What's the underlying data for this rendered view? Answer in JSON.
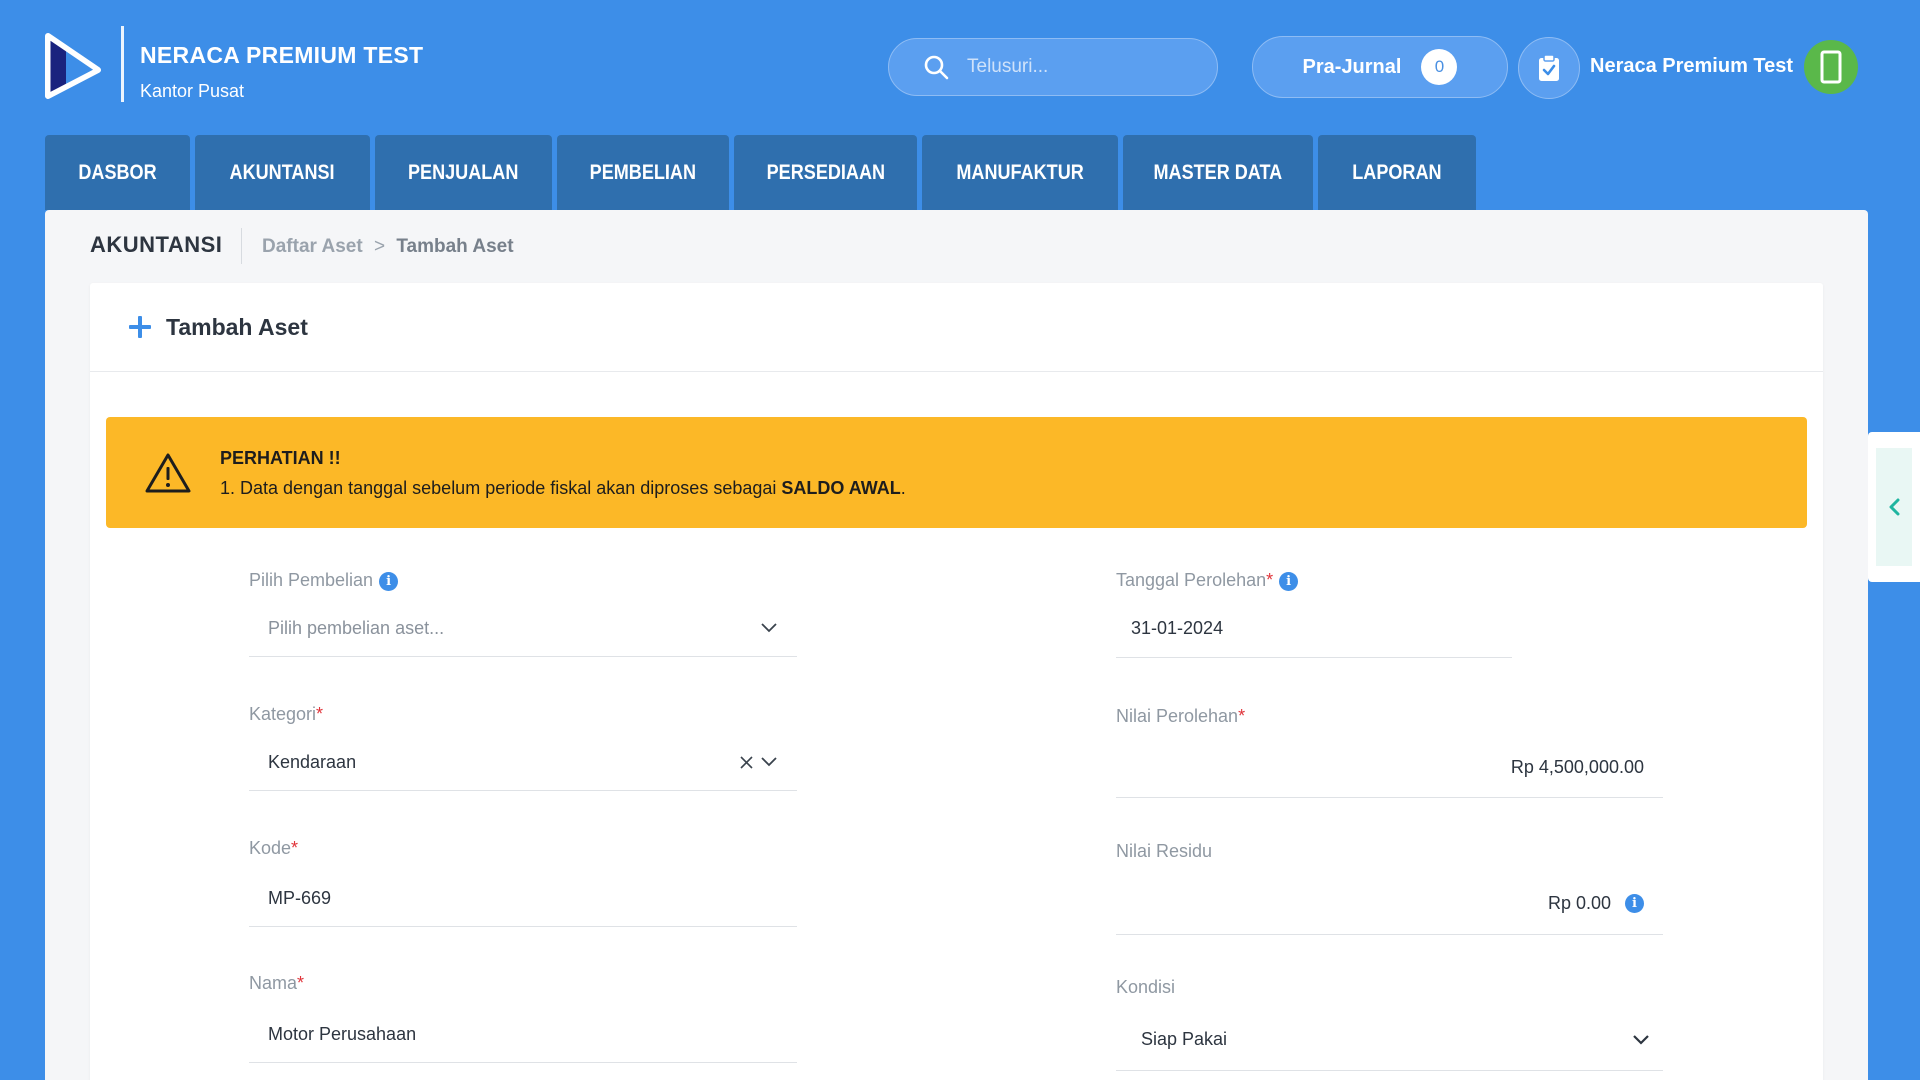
{
  "header": {
    "company_name": "NERACA PREMIUM TEST",
    "branch": "Kantor Pusat",
    "search_placeholder": "Telusuri...",
    "prajurnal_label": "Pra-Jurnal",
    "prajurnal_count": "0",
    "user_name": "Neraca Premium Test"
  },
  "nav": {
    "items": [
      "DASBOR",
      "AKUNTANSI",
      "PENJUALAN",
      "PEMBELIAN",
      "PERSEDIAAN",
      "MANUFAKTUR",
      "MASTER DATA",
      "LAPORAN"
    ]
  },
  "breadcrumb": {
    "module": "AKUNTANSI",
    "parent": "Daftar Aset",
    "separator": ">",
    "current": "Tambah Aset"
  },
  "card": {
    "title": "Tambah Aset"
  },
  "alert": {
    "heading": "PERHATIAN !!",
    "message_prefix": "1. Data dengan tanggal sebelum periode fiskal akan diproses sebagai ",
    "message_bold": "SALDO AWAL",
    "message_suffix": "."
  },
  "form": {
    "pilih_pembelian": {
      "label": "Pilih Pembelian",
      "placeholder": "Pilih pembelian aset..."
    },
    "kategori": {
      "label": "Kategori",
      "required": "*",
      "value": "Kendaraan"
    },
    "kode": {
      "label": "Kode",
      "required": "*",
      "value": "MP-669"
    },
    "nama": {
      "label": "Nama",
      "required": "*",
      "value": "Motor Perusahaan"
    },
    "tanggal_perolehan": {
      "label": "Tanggal Perolehan",
      "required": "*",
      "value": "31-01-2024"
    },
    "nilai_perolehan": {
      "label": "Nilai Perolehan",
      "required": "*",
      "value": "Rp 4,500,000.00"
    },
    "nilai_residu": {
      "label": "Nilai Residu",
      "value": "Rp 0.00"
    },
    "kondisi": {
      "label": "Kondisi",
      "value": "Siap Pakai"
    }
  },
  "colors": {
    "brand_blue": "#3d8ee8",
    "nav_tab": "#2f6fae",
    "alert": "#fcb827",
    "required": "#e0343a",
    "avatar": "#5ab84a"
  }
}
